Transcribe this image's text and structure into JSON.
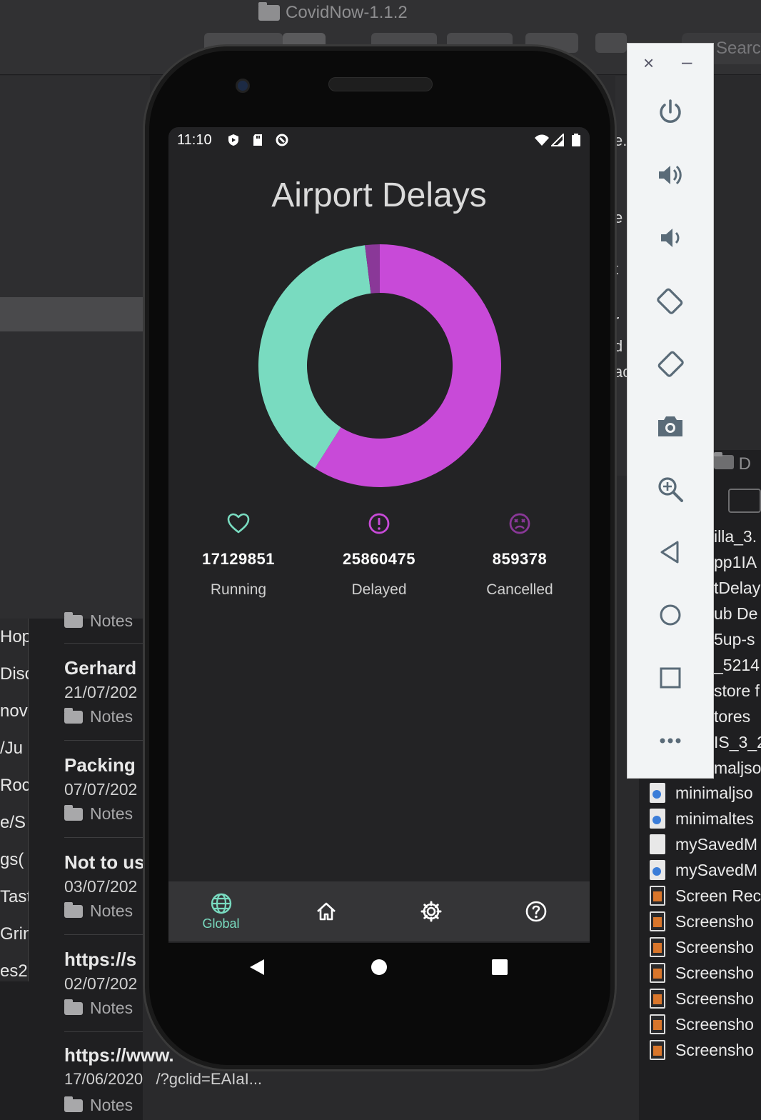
{
  "finder": {
    "window_title": "CovidNow-1.1.2",
    "search_placeholder": "Search"
  },
  "notes_strip": [
    "Hop",
    "Disc",
    "nov",
    "/Ju",
    "Roc",
    "e/S",
    "gs(",
    "Tast",
    "Grin",
    "es2"
  ],
  "notes": [
    {
      "title": "Notes",
      "date": "",
      "folder": "Notes"
    },
    {
      "title": "Gerhard",
      "date": "21/07/202",
      "folder": "Notes"
    },
    {
      "title": "Packing",
      "date": "07/07/202",
      "folder": "Notes"
    },
    {
      "title": "Not to us",
      "date": "03/07/202",
      "folder": "Notes"
    },
    {
      "title": "https://s",
      "date": "02/07/202",
      "folder": "Notes"
    },
    {
      "title": "https://www.",
      "date": "17/06/2020",
      "url_fragment": "/?gclid=EAIaI...",
      "folder": "Notes"
    }
  ],
  "mid_chars": [
    "e.",
    "e",
    "t",
    "r",
    "d",
    "ac"
  ],
  "files": {
    "header": "D",
    "text_rows": [
      "illa_3.",
      "pp1IA",
      "tDelay",
      "ub De",
      "5up-s",
      "_5214",
      "store f",
      "tores",
      "IS_3_2",
      "maljso"
    ],
    "rows": [
      {
        "name": "minimaljso",
        "icon": "file-blue"
      },
      {
        "name": "minimaltes",
        "icon": "file-blue"
      },
      {
        "name": "mySavedM",
        "icon": "file"
      },
      {
        "name": "mySavedM",
        "icon": "file-blue"
      },
      {
        "name": "Screen Rec",
        "icon": "screenshot"
      },
      {
        "name": "Screensho",
        "icon": "screenshot"
      },
      {
        "name": "Screensho",
        "icon": "screenshot"
      },
      {
        "name": "Screensho",
        "icon": "screenshot"
      },
      {
        "name": "Screensho",
        "icon": "screenshot"
      },
      {
        "name": "Screensho",
        "icon": "screenshot"
      },
      {
        "name": "Screensho",
        "icon": "screenshot"
      }
    ]
  },
  "phone": {
    "status_time": "11:10",
    "app_title": "Airport Delays",
    "donut": {
      "segments": [
        {
          "label": "Delayed",
          "value": 25860475,
          "color": "#c84ad8"
        },
        {
          "label": "Running",
          "value": 17129851,
          "color": "#79dbc0"
        },
        {
          "label": "Cancelled",
          "value": 859378,
          "color": "#8a3898"
        }
      ]
    },
    "stats": [
      {
        "label": "Running",
        "value": "17129851",
        "color": "#79dbc0",
        "icon": "heart-icon"
      },
      {
        "label": "Delayed",
        "value": "25860475",
        "color": "#c84ad8",
        "icon": "alert-circle-icon"
      },
      {
        "label": "Cancelled",
        "value": "859378",
        "color": "#8a3898",
        "icon": "sad-face-icon"
      }
    ],
    "nav": [
      {
        "label": "Global",
        "icon": "globe-icon",
        "active": true
      },
      {
        "label": "",
        "icon": "home-icon",
        "active": false
      },
      {
        "label": "",
        "icon": "settings-icon",
        "active": false
      },
      {
        "label": "",
        "icon": "help-icon",
        "active": false
      }
    ]
  },
  "emulator_toolbar": {
    "close": "×",
    "minimize": "–",
    "buttons": [
      "power-icon",
      "volume-up-icon",
      "volume-down-icon",
      "rotate-left-icon",
      "rotate-right-icon",
      "camera-icon",
      "zoom-icon",
      "back-icon",
      "home-circle-icon",
      "overview-icon",
      "more-icon"
    ]
  },
  "colors": {
    "accent_teal": "#79dbc0",
    "accent_purple": "#c84ad8",
    "dark_purple": "#8a3898",
    "screen_bg": "#232325",
    "nav_bg": "#353537"
  }
}
